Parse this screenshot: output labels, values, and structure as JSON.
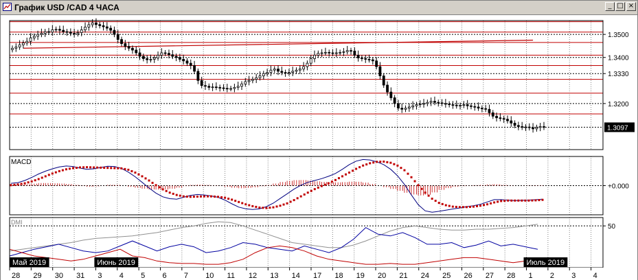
{
  "window": {
    "title": "График USD /CAD  4 ЧАСА",
    "buttons": {
      "minimize": "_",
      "maximize": "□",
      "close": "×"
    }
  },
  "chart_data": [
    {
      "type": "candlestick",
      "panel": "price",
      "ylim": [
        1.3,
        1.356
      ],
      "yticks": [
        "1.3500",
        "1.3400",
        "1.3330",
        "1.3200"
      ],
      "current_price": 1.3097,
      "current_price_label": "1.3097",
      "horizontal_levels": [
        1.3555,
        1.351,
        1.3465,
        1.341,
        1.3365,
        1.3305,
        1.3245,
        1.3155
      ],
      "trendline": {
        "from": [
          3,
          1.344
        ],
        "to": [
          143,
          1.3475
        ]
      },
      "closes": [
        1.344,
        1.3445,
        1.3455,
        1.3463,
        1.347,
        1.3485,
        1.3492,
        1.35,
        1.3505,
        1.3512,
        1.351,
        1.352,
        1.3522,
        1.3518,
        1.3512,
        1.351,
        1.3505,
        1.3503,
        1.3508,
        1.352,
        1.3532,
        1.3542,
        1.355,
        1.3543,
        1.3538,
        1.3533,
        1.3527,
        1.3518,
        1.35,
        1.3478,
        1.346,
        1.3448,
        1.344,
        1.3432,
        1.342,
        1.3405,
        1.3395,
        1.339,
        1.3392,
        1.3398,
        1.341,
        1.342,
        1.3418,
        1.3412,
        1.3405,
        1.34,
        1.3392,
        1.3385,
        1.3375,
        1.3365,
        1.334,
        1.33,
        1.3278,
        1.3275,
        1.327,
        1.3272,
        1.327,
        1.3268,
        1.3266,
        1.3265,
        1.3265,
        1.327,
        1.3275,
        1.3285,
        1.3295,
        1.33,
        1.3305,
        1.3312,
        1.332,
        1.333,
        1.3335,
        1.3345,
        1.335,
        1.334,
        1.3335,
        1.3332,
        1.3335,
        1.334,
        1.3345,
        1.335,
        1.336,
        1.3375,
        1.3395,
        1.341,
        1.3418,
        1.342,
        1.3422,
        1.342,
        1.3418,
        1.342,
        1.3422,
        1.3425,
        1.343,
        1.3428,
        1.341,
        1.3398,
        1.3395,
        1.3392,
        1.339,
        1.3385,
        1.336,
        1.332,
        1.328,
        1.325,
        1.3225,
        1.32,
        1.318,
        1.3175,
        1.318,
        1.3185,
        1.319,
        1.3195,
        1.3198,
        1.32,
        1.3205,
        1.321,
        1.3205,
        1.3203,
        1.32,
        1.3198,
        1.3195,
        1.3193,
        1.319,
        1.3192,
        1.3195,
        1.319,
        1.3187,
        1.3185,
        1.318,
        1.3178,
        1.3175,
        1.316,
        1.3145,
        1.3138,
        1.3135,
        1.3132,
        1.3125,
        1.3115,
        1.3105,
        1.31,
        1.3097,
        1.3098,
        1.3095,
        1.309,
        1.3096,
        1.31,
        1.3097
      ]
    },
    {
      "type": "line",
      "panel": "macd",
      "title": "MACD",
      "ylim": [
        -1,
        1
      ],
      "yticks": [
        "+0.000"
      ],
      "series": [
        {
          "values": [
            0.1,
            0.13,
            0.22,
            0.35,
            0.5,
            0.62,
            0.72,
            0.8,
            0.84,
            0.82,
            0.75,
            0.7,
            0.72,
            0.78,
            0.83,
            0.82,
            0.74,
            0.58,
            0.38,
            0.14,
            -0.1,
            -0.32,
            -0.48,
            -0.56,
            -0.58,
            -0.5,
            -0.42,
            -0.38,
            -0.4,
            -0.44,
            -0.5,
            -0.62,
            -0.78,
            -0.92,
            -0.99,
            -1.02,
            -0.99,
            -0.9,
            -0.75,
            -0.55,
            -0.35,
            -0.15,
            0.02,
            0.14,
            0.22,
            0.3,
            0.4,
            0.52,
            0.7,
            0.9,
            1.05,
            1.12,
            1.1,
            1.02,
            0.9,
            0.7,
            0.42,
            0.05,
            -0.4,
            -0.82,
            -1.08,
            -1.14,
            -1.1,
            -1.05,
            -1.0,
            -0.96,
            -0.9,
            -0.86,
            -0.8,
            -0.7,
            -0.6,
            -0.6,
            -0.62,
            -0.64,
            -0.63,
            -0.62,
            -0.6,
            -0.58
          ]
        },
        {
          "values": [
            0.02,
            0.05,
            0.1,
            0.18,
            0.28,
            0.4,
            0.52,
            0.62,
            0.7,
            0.75,
            0.78,
            0.79,
            0.78,
            0.77,
            0.76,
            0.75,
            0.74,
            0.68,
            0.56,
            0.4,
            0.22,
            0.02,
            -0.16,
            -0.3,
            -0.4,
            -0.46,
            -0.48,
            -0.47,
            -0.46,
            -0.46,
            -0.48,
            -0.52,
            -0.6,
            -0.7,
            -0.8,
            -0.88,
            -0.94,
            -0.96,
            -0.93,
            -0.86,
            -0.76,
            -0.62,
            -0.46,
            -0.3,
            -0.15,
            -0.02,
            0.1,
            0.24,
            0.4,
            0.56,
            0.72,
            0.86,
            0.96,
            1.02,
            1.03,
            0.98,
            0.86,
            0.66,
            0.36,
            0.02,
            -0.3,
            -0.56,
            -0.74,
            -0.84,
            -0.9,
            -0.92,
            -0.92,
            -0.9,
            -0.86,
            -0.8,
            -0.72,
            -0.66,
            -0.64,
            -0.64,
            -0.64,
            -0.64,
            -0.63,
            -0.61
          ]
        }
      ],
      "histogram": [
        0.08,
        0.08,
        0.12,
        0.17,
        0.22,
        0.22,
        0.2,
        0.18,
        0.14,
        0.07,
        -0.03,
        -0.09,
        -0.06,
        0.01,
        0.07,
        0.07,
        0.0,
        -0.1,
        -0.18,
        -0.26,
        -0.32,
        -0.34,
        -0.32,
        -0.26,
        -0.18,
        -0.04,
        0.06,
        0.09,
        0.06,
        0.02,
        -0.02,
        -0.1,
        -0.18,
        -0.22,
        -0.19,
        -0.14,
        -0.05,
        0.06,
        0.18,
        0.31,
        0.41,
        0.47,
        0.48,
        0.44,
        0.37,
        0.32,
        0.3,
        0.28,
        0.3,
        0.34,
        0.33,
        0.26,
        0.14,
        0.0,
        -0.13,
        -0.28,
        -0.44,
        -0.61,
        -0.76,
        -0.84,
        -0.78,
        -0.58,
        -0.36,
        -0.21,
        -0.1,
        -0.04,
        0.02,
        0.04,
        0.06,
        0.1,
        0.12,
        0.06,
        0.02,
        0.0,
        0.01,
        0.02,
        0.03,
        0.03
      ]
    },
    {
      "type": "line",
      "panel": "dmi",
      "title": "DMI",
      "ylim": [
        0,
        60
      ],
      "yticks": [
        "50"
      ],
      "series": [
        {
          "values": [
            20,
            22,
            24,
            26,
            28,
            30,
            33,
            35,
            36,
            37,
            38,
            40,
            42,
            45,
            48,
            50,
            53,
            55,
            54,
            50,
            45,
            40,
            35,
            30,
            28,
            26,
            24,
            24,
            27,
            32,
            38,
            44,
            48,
            50,
            48,
            46,
            45,
            45,
            46,
            46,
            47,
            48,
            50,
            52
          ]
        },
        {
          "values": [
            14,
            18,
            22,
            25,
            28,
            24,
            20,
            18,
            20,
            26,
            32,
            26,
            20,
            25,
            28,
            25,
            18,
            20,
            24,
            30,
            28,
            24,
            22,
            20,
            26,
            22,
            18,
            24,
            34,
            48,
            40,
            38,
            42,
            36,
            28,
            28,
            30,
            24,
            27,
            32,
            26,
            28,
            25,
            22
          ]
        },
        {
          "values": [
            22,
            18,
            14,
            12,
            10,
            8,
            10,
            14,
            18,
            22,
            14,
            12,
            8,
            6,
            5,
            5,
            4,
            4,
            6,
            10,
            18,
            24,
            26,
            24,
            20,
            14,
            10,
            8,
            6,
            4,
            4,
            5,
            4,
            4,
            6,
            8,
            10,
            12,
            12,
            10,
            8,
            6,
            8,
            10
          ]
        }
      ]
    }
  ],
  "time_axis": {
    "day_labels": [
      "28",
      "29",
      "30",
      "31",
      "3",
      "4",
      "5",
      "6",
      "7",
      "10",
      "11",
      "12",
      "13",
      "14",
      "17",
      "18",
      "19",
      "20",
      "21",
      "24",
      "25",
      "26",
      "27",
      "28",
      "1",
      "2",
      "3",
      "4"
    ],
    "month_labels": [
      "Май 2019",
      "Июнь 2019",
      "Июль 2019"
    ]
  },
  "colors": {
    "candle": "#000000",
    "grid": "#808080",
    "level": "#c00000",
    "macd_line": "#000080",
    "macd_signal": "#c00000",
    "macd_hist": "#c00000",
    "dmi_adx": "#909090",
    "dmi_plus": "#0000a0",
    "dmi_minus": "#c00000",
    "price_box": "#000000"
  }
}
